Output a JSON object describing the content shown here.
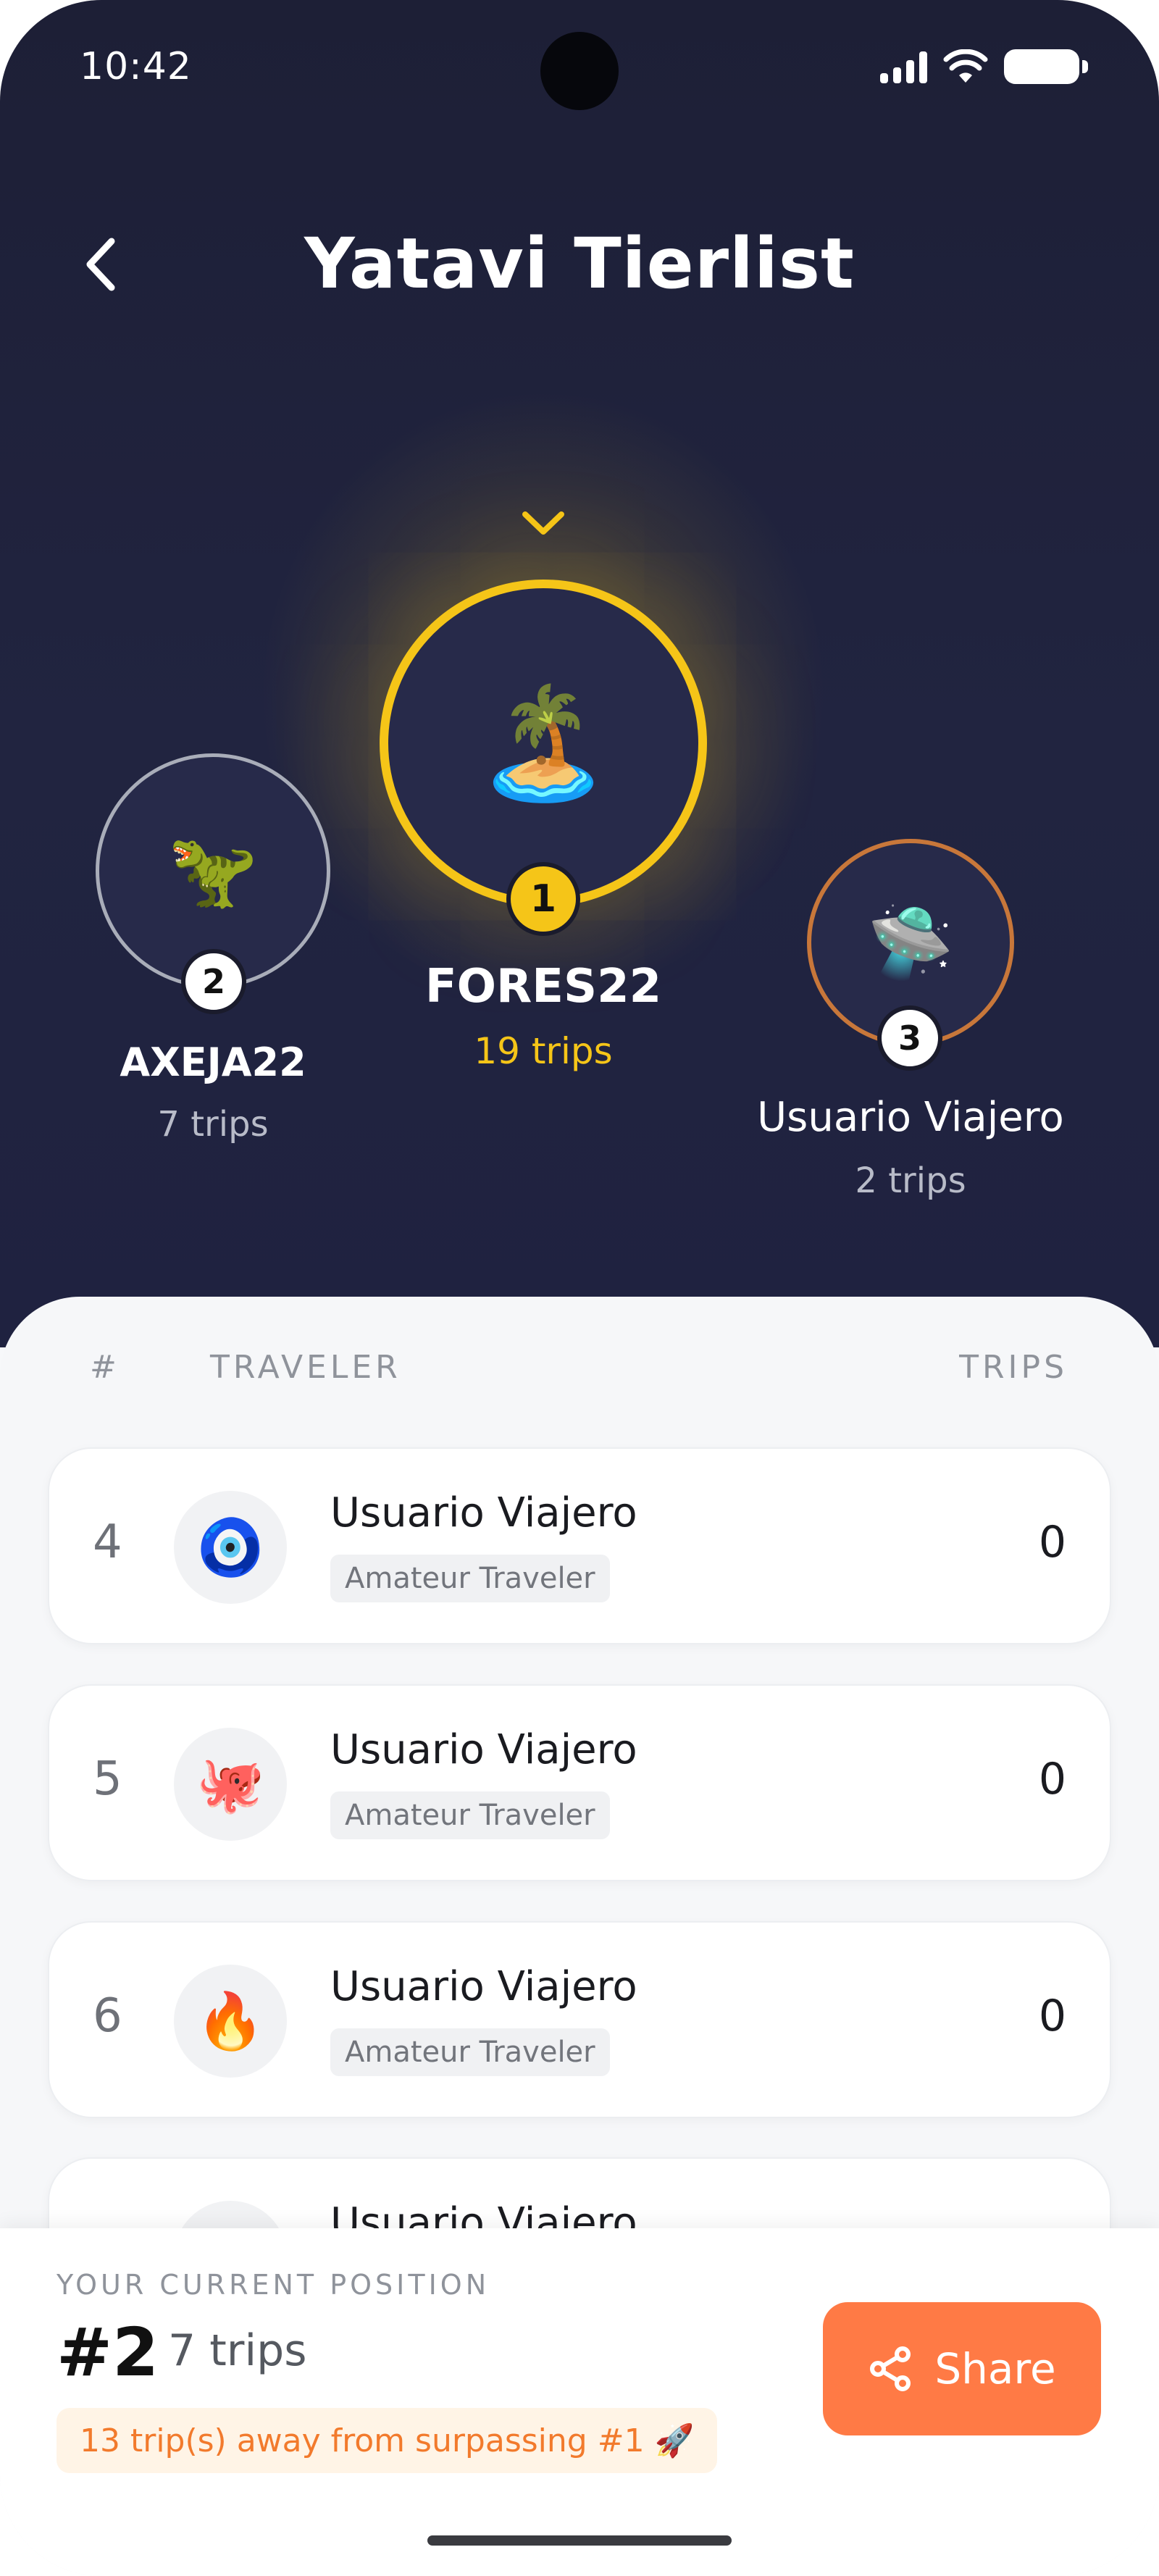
{
  "status_bar": {
    "time": "10:42"
  },
  "header": {
    "title": "Yatavi Tierlist"
  },
  "podium": [
    {
      "rank": "1",
      "name": "FORES22",
      "trips": "19 trips",
      "avatar": "🏝️"
    },
    {
      "rank": "2",
      "name": "AXEJA22",
      "trips": "7 trips",
      "avatar": "🦖"
    },
    {
      "rank": "3",
      "name": "Usuario Viajero",
      "trips": "2 trips",
      "avatar": "🛸"
    }
  ],
  "list": {
    "headers": {
      "rank": "#",
      "traveler": "TRAVELER",
      "trips": "TRIPS"
    },
    "rows": [
      {
        "rank": "4",
        "avatar": "🧿",
        "name": "Usuario Viajero",
        "tag": "Amateur Traveler",
        "trips": "0"
      },
      {
        "rank": "5",
        "avatar": "🐙",
        "name": "Usuario Viajero",
        "tag": "Amateur Traveler",
        "trips": "0"
      },
      {
        "rank": "6",
        "avatar": "🔥",
        "name": "Usuario Viajero",
        "tag": "Amateur Traveler",
        "trips": "0"
      },
      {
        "rank": "",
        "avatar": "",
        "name": "Usuario Viajero",
        "tag": "",
        "trips": ""
      }
    ]
  },
  "current_position": {
    "label": "YOUR CURRENT POSITION",
    "rank": "#2",
    "trips": "7 trips",
    "note": "13 trip(s) away from surpassing #1 🚀"
  },
  "share": {
    "label": "Share"
  },
  "colors": {
    "gold": "#f5c518",
    "silver": "#a9adb9",
    "bronze": "#c8773a",
    "accent": "#ff7a45",
    "hero_bg": "#1f2240"
  }
}
